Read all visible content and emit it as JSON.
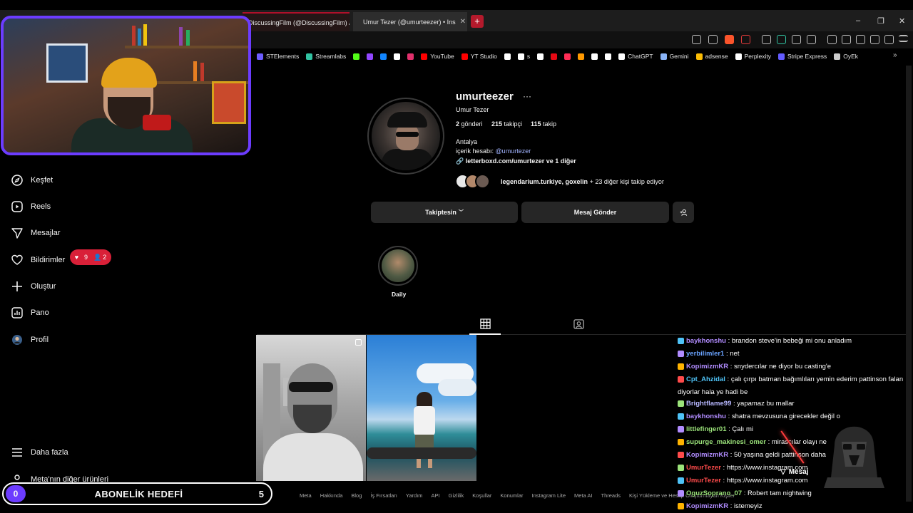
{
  "browser": {
    "tabs": [
      {
        "label": "DiscussingFilm (@DiscussingFilm) / X",
        "active": false
      },
      {
        "label": "Umur Tezer (@umurteezer) • Ins",
        "active": true
      }
    ],
    "new_tab": "+",
    "window_controls": [
      "–",
      "❐",
      "✕"
    ],
    "bookmarks": [
      {
        "label": "STElements",
        "color": "#6c5cff"
      },
      {
        "label": "Streamlabs",
        "color": "#31c3a2"
      },
      {
        "label": "",
        "color": "#53fc18"
      },
      {
        "label": "",
        "color": "#9146ff"
      },
      {
        "label": "",
        "color": "#1185fe"
      },
      {
        "label": "",
        "color": "#ffffff"
      },
      {
        "label": "",
        "color": "#e1306c"
      },
      {
        "label": "YouTube",
        "color": "#ff0000"
      },
      {
        "label": "YT Studio",
        "color": "#ff0000"
      },
      {
        "label": "",
        "color": "#ffffff"
      },
      {
        "label": "s",
        "color": "#ffffff"
      },
      {
        "label": "",
        "color": "#ffffff"
      },
      {
        "label": "",
        "color": "#e50914"
      },
      {
        "label": "",
        "color": "#ff2d55"
      },
      {
        "label": "",
        "color": "#ff9900"
      },
      {
        "label": "",
        "color": "#ffffff"
      },
      {
        "label": "",
        "color": "#ffffff"
      },
      {
        "label": "ChatGPT",
        "color": "#ffffff"
      },
      {
        "label": "Gemini",
        "color": "#8ab4f8"
      },
      {
        "label": "adsense",
        "color": "#fbbc04"
      },
      {
        "label": "Perplexity",
        "color": "#ffffff"
      },
      {
        "label": "Stripe Express",
        "color": "#635bff"
      },
      {
        "label": "OyEk",
        "color": "#cccccc"
      }
    ]
  },
  "sidebar": {
    "items": [
      {
        "label": "Keşfet",
        "icon": "compass-icon"
      },
      {
        "label": "Reels",
        "icon": "reels-icon"
      },
      {
        "label": "Mesajlar",
        "icon": "send-icon"
      },
      {
        "label": "Bildirimler",
        "icon": "heart-icon"
      },
      {
        "label": "Oluştur",
        "icon": "plus-icon"
      },
      {
        "label": "Pano",
        "icon": "dashboard-icon"
      },
      {
        "label": "Profil",
        "icon": "avatar-icon"
      }
    ],
    "more": "Daha fazla",
    "meta_other": "Meta'nın diğer ürünleri",
    "notif_badge": {
      "likes": "9",
      "followers": "2"
    }
  },
  "profile": {
    "username": "umurteezer",
    "full_name": "Umur Tezer",
    "posts_count": "2",
    "posts_label": "gönderi",
    "followers_count": "215",
    "followers_label": "takipçi",
    "following_count": "115",
    "following_label": "takip",
    "bio_location": "Antalya",
    "bio_account_label": "içerik hesabı:",
    "bio_account_handle": "@umurtezer",
    "link": "letterboxd.com/umurtezer ve 1 diğer",
    "followed_by_names": "legendarium.turkiye, goxelin",
    "followed_by_rest": "+ 23 diğer kişi takip ediyor",
    "buttons": {
      "following": "Takiptesin",
      "message": "Mesaj Gönder"
    },
    "highlight_label": "Daily"
  },
  "footer_links": [
    "Meta",
    "Hakkında",
    "Blog",
    "İş Fırsatları",
    "Yardım",
    "API",
    "Gizlilik",
    "Koşullar",
    "Konumlar",
    "Instagram Lite",
    "Meta AI",
    "Threads",
    "Kişi Yükleme ve Hesap Oluşturmayan Kişiler"
  ],
  "chat": [
    {
      "user": "baykhonshu",
      "color": "#b18cff",
      "text": "brandon steve'in bebeği mi onu anladım"
    },
    {
      "user": "yerbilimler1",
      "color": "#6aa3ff",
      "text": "net"
    },
    {
      "user": "KopimizmKR",
      "color": "#b18cff",
      "text": "snydercılar ne diyor bu casting'e"
    },
    {
      "user": "Cpt_Ahzidal",
      "color": "#4fc3f7",
      "text": "çalı çırpı batman bağımlıları yemin ederim pattinson falan diyorlar hala ye hadi be"
    },
    {
      "user": "Brightflame99",
      "color": "#b7b7ff",
      "text": "yapamaz bu mallar"
    },
    {
      "user": "baykhonshu",
      "color": "#b18cff",
      "text": "shatra mevzusuna girecekler değil o"
    },
    {
      "user": "littlefinger01",
      "color": "#9be37a",
      "text": "Çalı mi"
    },
    {
      "user": "supurge_makinesi_omer",
      "color": "#9be37a",
      "text": "mirasçılar olayı ne"
    },
    {
      "user": "KopimizmKR",
      "color": "#b18cff",
      "text": "50 yaşına geldi pattinson daha"
    },
    {
      "user": "UmurTezer",
      "color": "#ff4b4b",
      "text": "https://www.instagram.com"
    },
    {
      "user": "UmurTezer",
      "color": "#ff4b4b",
      "text": "https://www.instagram.com"
    },
    {
      "user": "OguzSoprano_07",
      "color": "#9be37a",
      "text": "Robert tam nightwing"
    },
    {
      "user": "KopimizmKR",
      "color": "#b18cff",
      "text": "istemeyiz"
    }
  ],
  "overlay_message_label": "Mesaj",
  "sub_goal": {
    "start": "0",
    "title": "ABONELİK HEDEFİ",
    "end": "5"
  },
  "colors": {
    "accent_purple": "#6c3cff",
    "badge_red": "#d92038",
    "link_blue": "#a2b4ff"
  }
}
